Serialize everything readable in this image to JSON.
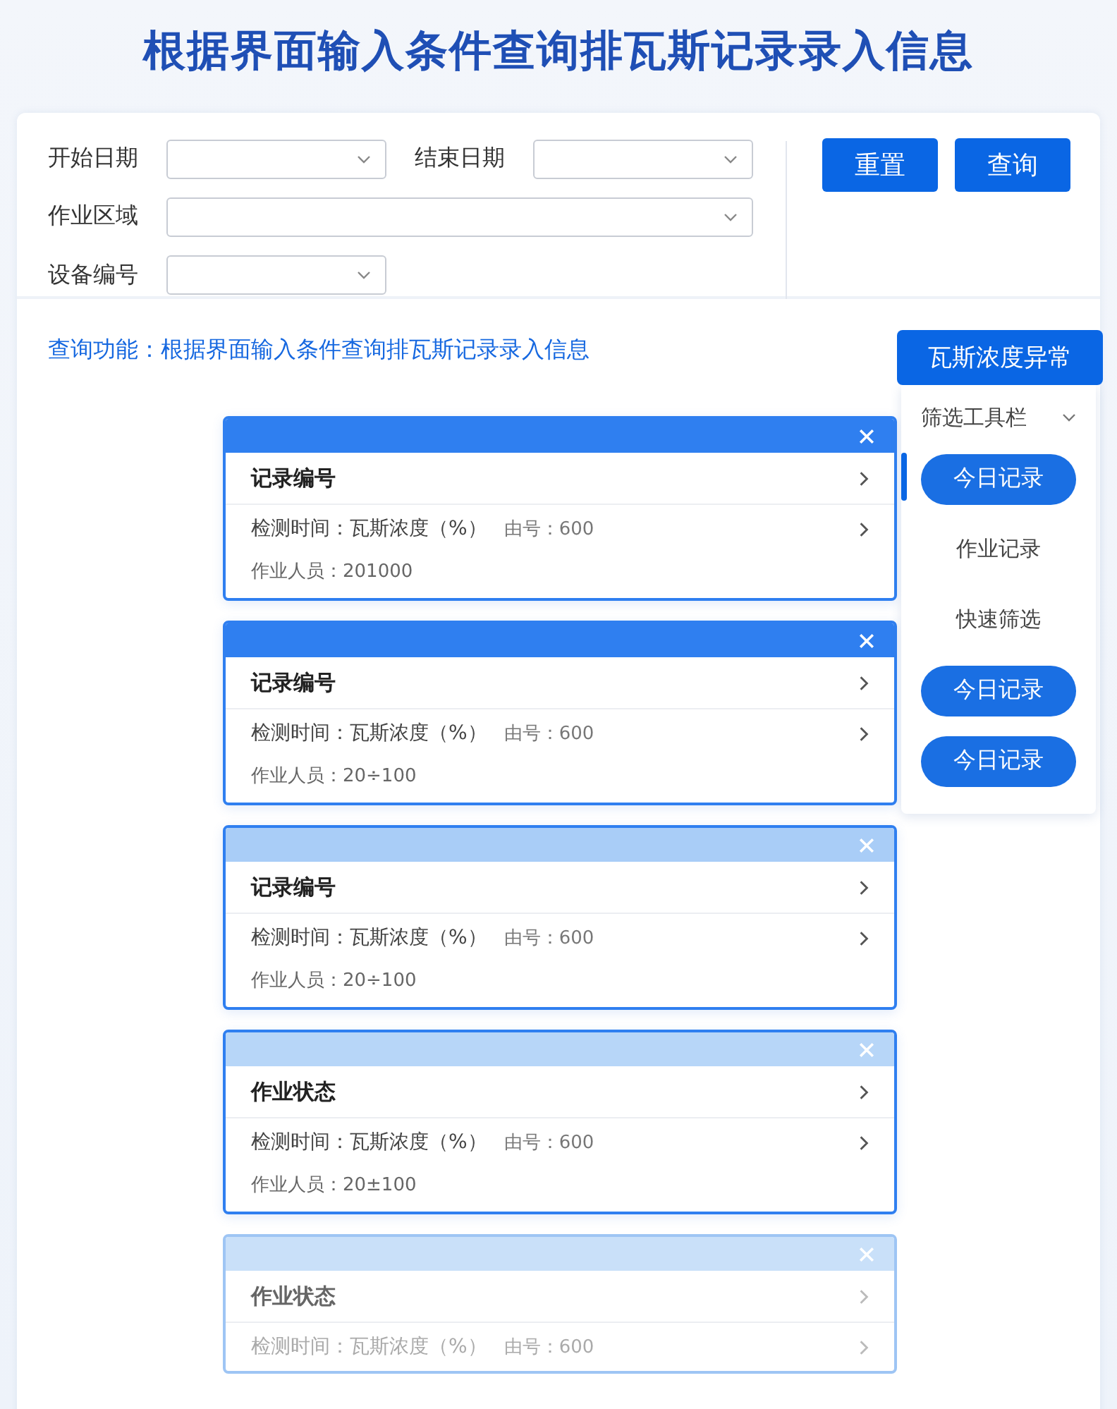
{
  "title": "根据界面输入条件查询排瓦斯记录录入信息",
  "filters": [
    {
      "label": "开始日期",
      "kind": "short"
    },
    {
      "label": "结束日期",
      "kind": "short"
    },
    {
      "label": "作业区域",
      "kind": "wide"
    },
    {
      "label": "设备编号",
      "kind": "short"
    }
  ],
  "buttons": [
    "重置",
    "查询"
  ],
  "description": "查询功能：根据界面输入条件查询排瓦斯记录录入信息",
  "cards": [
    {
      "color": "#2f7ff0",
      "faded": false,
      "heading": "记录编号",
      "detail": "检测时间：瓦斯浓度（%）",
      "number": "由号：600",
      "staff": "作业人员：201000"
    },
    {
      "color": "#2f7ff0",
      "faded": false,
      "heading": "记录编号",
      "detail": "检测时间：瓦斯浓度（%）",
      "number": "由号：600",
      "staff": "作业人员：20÷100"
    },
    {
      "color": "#a9cdf7",
      "faded": false,
      "heading": "记录编号",
      "detail": "检测时间：瓦斯浓度（%）",
      "number": "由号：600",
      "staff": "作业人员：20÷100"
    },
    {
      "color": "#b7d6f8",
      "faded": false,
      "heading": "作业状态",
      "detail": "检测时间：瓦斯浓度（%）",
      "number": "由号：600",
      "staff": "作业人员：20±100"
    },
    {
      "color": "#c9e0f9",
      "faded": true,
      "heading": "作业状态",
      "detail": "检测时间：瓦斯浓度（%）",
      "number": "由号：600"
    }
  ],
  "sidebar": {
    "title": "瓦斯浓度异常",
    "dropdown": "筛选工具栏",
    "items": [
      {
        "label": "今日记录",
        "kind": "pill",
        "selected": true
      },
      {
        "label": "作业记录",
        "kind": "text",
        "selected": false
      },
      {
        "label": "快速筛选",
        "kind": "text",
        "selected": false
      },
      {
        "label": "今日记录",
        "kind": "pill",
        "selected": false
      },
      {
        "label": "今日记录",
        "kind": "pill",
        "selected": false
      }
    ]
  }
}
